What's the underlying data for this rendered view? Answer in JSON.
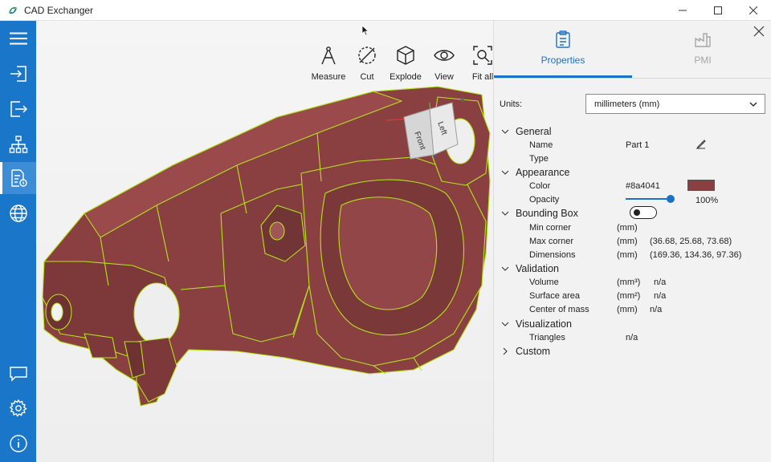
{
  "window": {
    "title": "CAD Exchanger"
  },
  "icons": {
    "logo": "cad-exchanger-logo-icon",
    "minimize": "minimize-icon",
    "maximize": "maximize-icon",
    "close": "close-icon"
  },
  "colors": {
    "sidebar": "#1976c9",
    "accent": "#1a73c8",
    "part": "#8a4041",
    "edge": "#b5e31c"
  },
  "sidebar": {
    "items": [
      {
        "icon": "hamburger-menu-icon"
      },
      {
        "icon": "import-icon"
      },
      {
        "icon": "export-icon"
      },
      {
        "icon": "structure-tree-icon"
      },
      {
        "icon": "document-properties-icon",
        "active": true
      },
      {
        "icon": "globe-icon"
      },
      {
        "icon": "chat-icon"
      },
      {
        "icon": "gear-icon"
      },
      {
        "icon": "info-icon"
      }
    ]
  },
  "toolbar": {
    "items": [
      {
        "label": "Measure",
        "icon": "compass-icon"
      },
      {
        "label": "Cut",
        "icon": "cut-section-icon"
      },
      {
        "label": "Explode",
        "icon": "cube-explode-icon"
      },
      {
        "label": "View",
        "icon": "eye-icon"
      },
      {
        "label": "Fit all",
        "icon": "fit-all-icon"
      }
    ]
  },
  "viewcube": {
    "front": "Front",
    "left": "Left"
  },
  "panel": {
    "tabs": [
      {
        "label": "Properties",
        "icon": "clipboard-icon",
        "active": true
      },
      {
        "label": "PMI",
        "icon": "factory-icon",
        "active": false
      }
    ],
    "units_label": "Units:",
    "units_value": "millimeters (mm)",
    "sections": {
      "general": {
        "title": "General",
        "name_label": "Name",
        "name_value": "Part 1",
        "type_label": "Type"
      },
      "appearance": {
        "title": "Appearance",
        "color_label": "Color",
        "color_value": "#8a4041",
        "opacity_label": "Opacity",
        "opacity_value": "100%",
        "opacity": 1.0
      },
      "bounding_box": {
        "title": "Bounding Box",
        "toggle_on": false,
        "min_label": "Min corner",
        "min_unit": "(mm)",
        "max_label": "Max corner",
        "max_unit": "(mm)",
        "max_value": "(36.68, 25.68, 73.68)",
        "dim_label": "Dimensions",
        "dim_unit": "(mm)",
        "dim_value": "(169.36, 134.36, 97.36)"
      },
      "validation": {
        "title": "Validation",
        "volume_label": "Volume",
        "volume_unit": "(mm³)",
        "volume_value": "n/a",
        "area_label": "Surface area",
        "area_unit": "(mm²)",
        "area_value": "n/a",
        "com_label": "Center of mass",
        "com_unit": "(mm)",
        "com_value": "n/a"
      },
      "visualization": {
        "title": "Visualization",
        "triangles_label": "Triangles",
        "triangles_value": "n/a"
      },
      "custom": {
        "title": "Custom"
      }
    }
  }
}
